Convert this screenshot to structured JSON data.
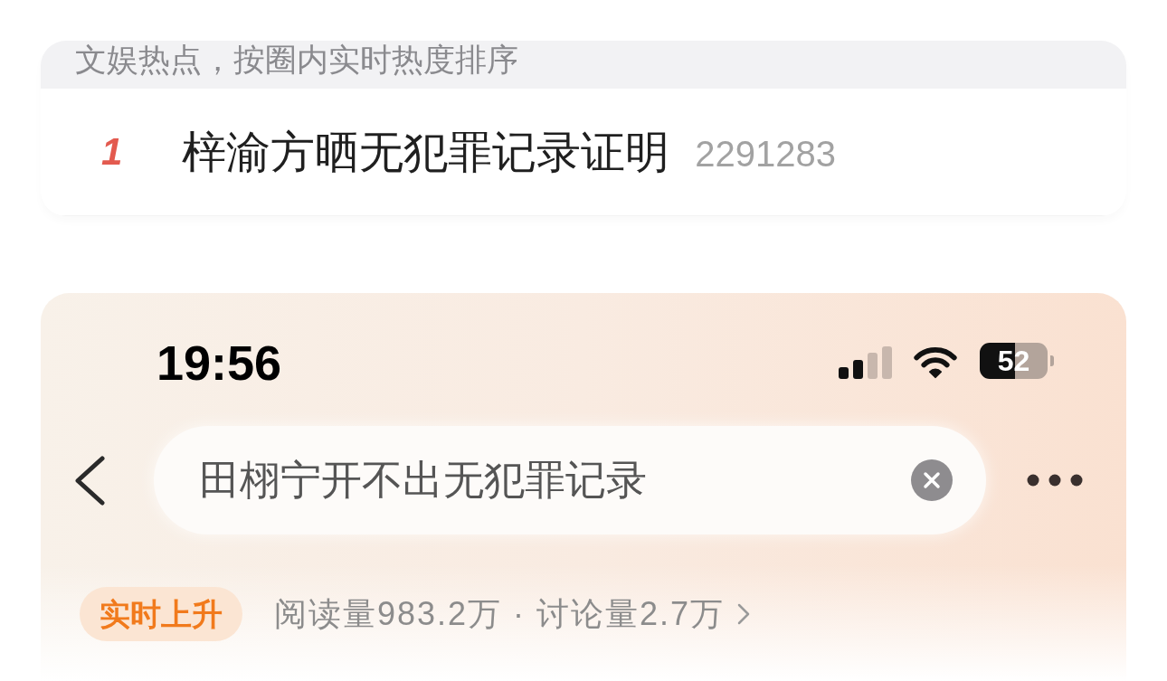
{
  "hot_list": {
    "header": "文娱热点，按圈内实时热度排序",
    "items": [
      {
        "rank": "1",
        "title": "梓渝方晒无犯罪记录证明",
        "heat": "2291283"
      }
    ]
  },
  "phone": {
    "status_bar": {
      "time": "19:56",
      "battery": "52"
    },
    "search": {
      "value": "田栩宁开不出无犯罪记录"
    },
    "topic": {
      "badge": "实时上升",
      "stats": "阅读量983.2万 · 讨论量2.7万"
    }
  }
}
